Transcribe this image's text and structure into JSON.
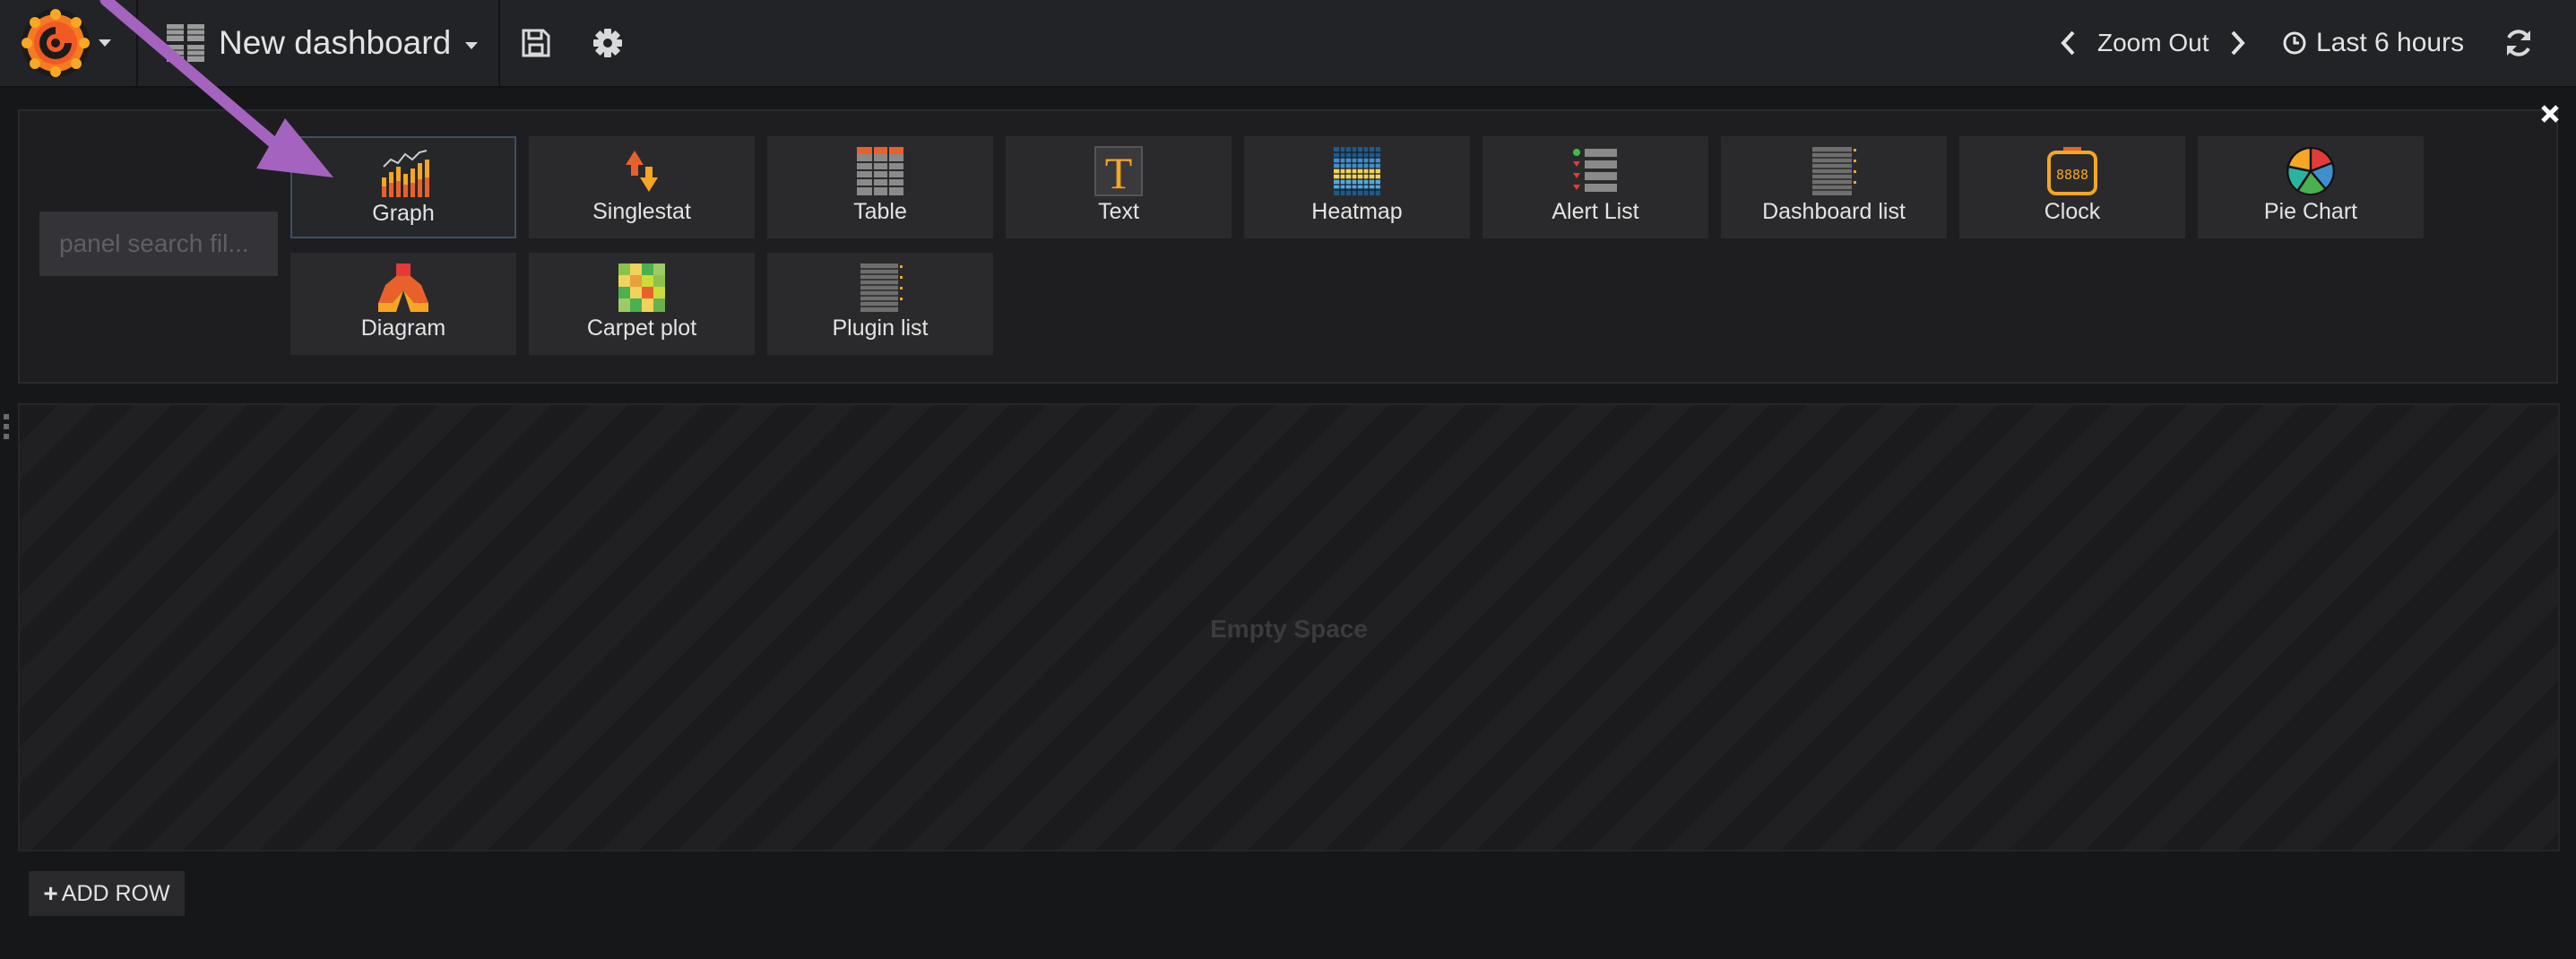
{
  "header": {
    "dashboard_title": "New dashboard",
    "zoom_label": "Zoom Out",
    "time_range": "Last 6 hours"
  },
  "panel_picker": {
    "search_placeholder": "panel search fil...",
    "panels": [
      {
        "label": "Graph",
        "icon": "graph-panel-icon"
      },
      {
        "label": "Singlestat",
        "icon": "singlestat-panel-icon"
      },
      {
        "label": "Table",
        "icon": "table-panel-icon"
      },
      {
        "label": "Text",
        "icon": "text-panel-icon"
      },
      {
        "label": "Heatmap",
        "icon": "heatmap-panel-icon"
      },
      {
        "label": "Alert List",
        "icon": "alert-list-panel-icon"
      },
      {
        "label": "Dashboard list",
        "icon": "dashboard-list-panel-icon"
      },
      {
        "label": "Clock",
        "icon": "clock-panel-icon"
      },
      {
        "label": "Pie Chart",
        "icon": "pie-chart-panel-icon"
      },
      {
        "label": "Diagram",
        "icon": "diagram-panel-icon"
      },
      {
        "label": "Carpet plot",
        "icon": "carpet-plot-panel-icon"
      },
      {
        "label": "Plugin list",
        "icon": "plugin-list-panel-icon"
      }
    ]
  },
  "row": {
    "empty_text": "Empty Space",
    "add_row_label": "ADD ROW"
  },
  "colors": {
    "background": "#161719",
    "navbar": "#222326",
    "tile": "#2a2a2c",
    "annotation_arrow": "#a463bf",
    "grafana_orange": "#f5a623"
  }
}
